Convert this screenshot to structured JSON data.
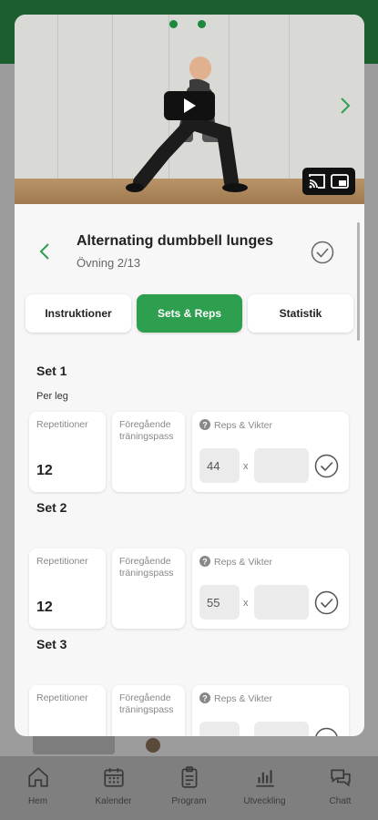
{
  "video": {
    "page_dots": 2,
    "play_icon": "play-icon",
    "next_icon": "chevron-right-icon",
    "cast_icon": "cast-icon",
    "pip_icon": "picture-in-picture-icon"
  },
  "exercise": {
    "title": "Alternating dumbbell lunges",
    "subtitle": "Övning 2/13"
  },
  "tabs": [
    {
      "label": "Instruktioner",
      "active": false
    },
    {
      "label": "Sets & Reps",
      "active": true
    },
    {
      "label": "Statistik",
      "active": false
    }
  ],
  "sets": [
    {
      "title": "Set 1",
      "note": "Per leg",
      "rep_label": "Repetitioner",
      "rep_value": "12",
      "prev_label": "Föregående träningspass",
      "rw_label": "Reps & Vikter",
      "reps_input": "44",
      "times": "x",
      "weight_input": ""
    },
    {
      "title": "Set 2",
      "note": "",
      "rep_label": "Repetitioner",
      "rep_value": "12",
      "prev_label": "Föregående träningspass",
      "rw_label": "Reps & Vikter",
      "reps_input": "55",
      "times": "x",
      "weight_input": ""
    },
    {
      "title": "Set 3",
      "note": "",
      "rep_label": "Repetitioner",
      "rep_value": "",
      "prev_label": "Föregående träningspass",
      "rw_label": "Reps & Vikter",
      "reps_input": "",
      "times": "",
      "weight_input": ""
    }
  ],
  "nav": [
    {
      "label": "Hem",
      "icon": "home-icon"
    },
    {
      "label": "Kalender",
      "icon": "calendar-icon"
    },
    {
      "label": "Program",
      "icon": "clipboard-icon"
    },
    {
      "label": "Utveckling",
      "icon": "bar-chart-icon"
    },
    {
      "label": "Chatt",
      "icon": "chat-icon"
    }
  ],
  "colors": {
    "accent": "#2e9e4f",
    "header": "#1c5e2e"
  }
}
